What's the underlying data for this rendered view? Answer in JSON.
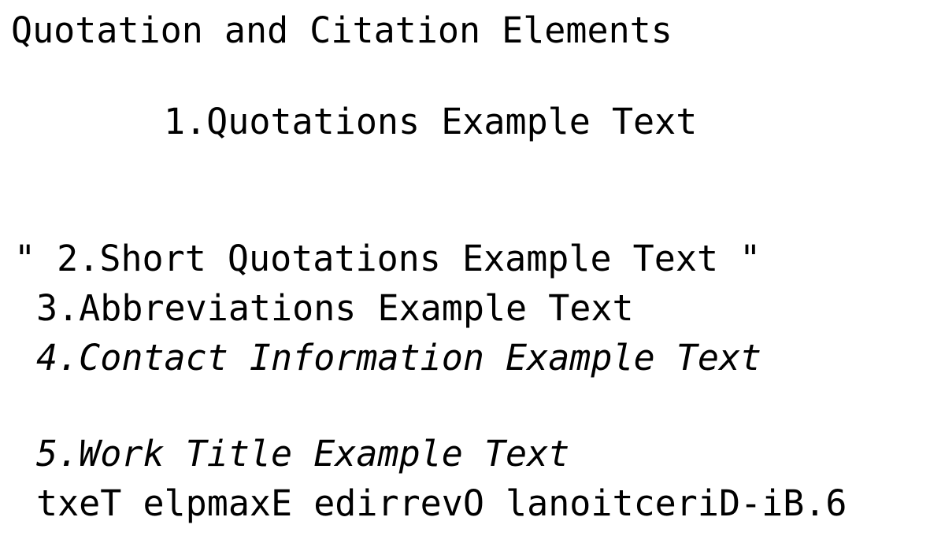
{
  "title": "Quotation and Citation Elements",
  "items": {
    "quotations": "1.Quotations Example Text",
    "short_quote_open": "\"",
    "short_quote": " 2.Short Quotations Example Text ",
    "short_quote_close": "\"",
    "abbreviations": "3.Abbreviations Example Text",
    "contact": "4.Contact Information Example Text",
    "work_title": "5.Work Title Example Text",
    "bdo": "txeT elpmaxE edirrevO lanoitceriD-iB.6"
  }
}
